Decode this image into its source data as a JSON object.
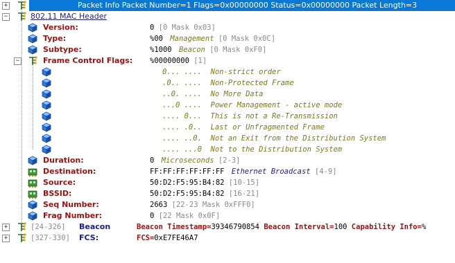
{
  "top": {
    "line": "Packet Info Packet Number=1 Flags=0x00000000 Status=0x00000000 Packet Length=3"
  },
  "mac_header": {
    "label": "802.11 MAC Header"
  },
  "fields": [
    {
      "label": "Version:",
      "value": "0",
      "extra": "[0 Mask 0x03]"
    },
    {
      "label": "Type:",
      "value": "%00",
      "desc": "Management",
      "extra": "[0 Mask 0x0C]"
    },
    {
      "label": "Subtype:",
      "value": "%1000",
      "desc": "Beacon",
      "extra": "[0 Mask 0xF0]"
    },
    {
      "label": "Frame Control Flags:",
      "value": "%00000000",
      "extra": "[1]"
    }
  ],
  "flags": [
    "0... ....  Non-strict order",
    ".0.. ....  Non-Protected Frame",
    "..0. ....  No More Data",
    "...0 ....  Power Management - active mode",
    ".... 0...  This is not a Re-Transmission",
    ".... .0..  Last or Unfragmented Frame",
    ".... ..0.  Not an Exit from the Distribution System",
    ".... ...0  Not to the Distribution System"
  ],
  "duration": {
    "label": "Duration:",
    "value": "0",
    "desc": "Microseconds",
    "extra": "[2-3]"
  },
  "addresses": [
    {
      "label": "Destination:",
      "value": "FF:FF:FF:FF:FF:FF",
      "desc": "Ethernet Broadcast",
      "extra": "[4-9]"
    },
    {
      "label": "Source:",
      "value": "50:D2:F5:95:B4:82",
      "extra": "[10-15]"
    },
    {
      "label": "BSSID:",
      "value": "50:D2:F5:95:B4:82",
      "extra": "[16-21]"
    }
  ],
  "seq": {
    "label": "Seq Number:",
    "value": "2663",
    "extra": "[22-23 Mask 0xFFF0]"
  },
  "frag": {
    "label": "Frag Number:",
    "value": "0",
    "extra": "[22 Mask 0x0F]"
  },
  "beacon": {
    "range": "[24-326]",
    "name": "Beacon",
    "ts_label": "Beacon Timestamp=",
    "ts_value": "39346790854",
    "int_label": "Beacon Interval=",
    "int_value": "100",
    "cap_label": "Capability Info=",
    "cap_value": "%"
  },
  "fcs": {
    "range": "[327-330]",
    "name": "FCS:",
    "label": "FCS=",
    "value": "0xE7FE46A7"
  },
  "colors": {
    "selection": "#0b78d6",
    "label": "#a01010",
    "desc": "#7a7a1a",
    "link": "#0000aa"
  }
}
